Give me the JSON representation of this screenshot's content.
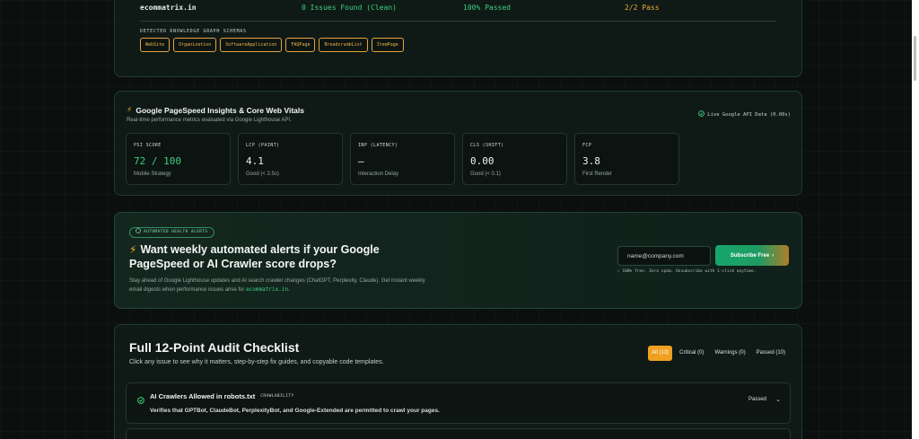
{
  "schema_card": {
    "domain": "ecommatrix.in",
    "issues": "0 Issues Found (Clean)",
    "passed": "100% Passed",
    "pass_ratio": "2/2 Pass",
    "schemas_label": "DETECTED KNOWLEDGE GRAPH SCHEMAS",
    "schemas": [
      "WebSite",
      "Organization",
      "SoftwareApplication",
      "FAQPage",
      "BreadcrumbList",
      "ItemPage"
    ]
  },
  "psi_card": {
    "title": "Google PageSpeed Insights & Core Web Vitals",
    "subtitle": "Real-time performance metrics evaluated via Google Lighthouse API.",
    "live_badge": "Live Google API Data (0.00s)",
    "metrics": [
      {
        "label": "PSI SCORE",
        "value": "72 / 100",
        "note": "Mobile Strategy"
      },
      {
        "label": "LCP (PAINT)",
        "value": "4.1",
        "note": "Good (< 2.5s)"
      },
      {
        "label": "INP (LATENCY)",
        "value": "—",
        "note": "Interaction Delay"
      },
      {
        "label": "CLS (SHIFT)",
        "value": "0.00",
        "note": "Good (< 0.1)"
      },
      {
        "label": "FCP",
        "value": "3.8",
        "note": "First Render"
      }
    ]
  },
  "alerts_card": {
    "badge": "AUTOMATED HEALTH ALERTS",
    "heading": "Want weekly automated alerts if your Google PageSpeed or AI Crawler score drops?",
    "desc_before": "Stay ahead of Google Lighthouse updates and AI search crawler changes (ChatGPT, Perplexity, Claude). Get instant weekly email digests when performance issues arise for ",
    "desc_domain": "ecommatrix.in",
    "desc_after": ".",
    "email_placeholder": "name@company.com",
    "subscribe_label": "Subscribe Free",
    "note": "✓ 100% free. Zero spam. Unsubscribe with 1-click anytime."
  },
  "checklist_card": {
    "title": "Full 12-Point Audit Checklist",
    "subtitle": "Click any issue to see why it matters, step-by-step fix guides, and copyable code templates.",
    "filters": [
      "All (13)",
      "Critical (0)",
      "Warnings (0)",
      "Passed (10)"
    ],
    "item": {
      "title": "AI Crawlers Allowed in robots.txt",
      "category": "CRAWLABILITY",
      "desc": "Verifies that GPTBot, ClaudeBot, PerplexityBot, and Google-Extended are permitted to crawl your pages.",
      "status": "Passed"
    }
  },
  "colors": {
    "accent_green": "#3ccf82",
    "accent_orange": "#f0a020"
  },
  "icons": [
    "bolt-icon",
    "check-circle-icon",
    "chevron-down-icon",
    "arrow-right-icon"
  ]
}
